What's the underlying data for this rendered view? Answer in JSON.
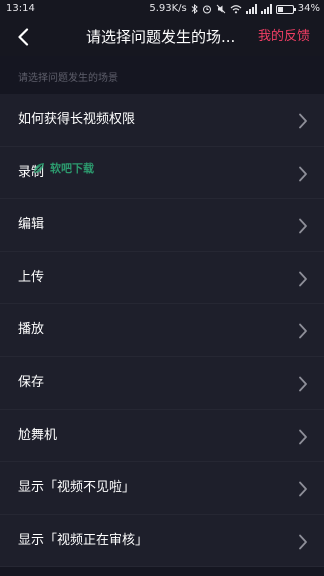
{
  "status_bar": {
    "time": "13:14",
    "network_speed": "5.93K/s",
    "battery_text": "34%",
    "battery_level": 0.34
  },
  "header": {
    "title": "请选择问题发生的场...",
    "feedback_link": "我的反馈"
  },
  "section_label": "请选择问题发生的场景",
  "scenarios": [
    {
      "label": "如何获得长视频权限"
    },
    {
      "label": "录制"
    },
    {
      "label": "编辑"
    },
    {
      "label": "上传"
    },
    {
      "label": "播放"
    },
    {
      "label": "保存"
    },
    {
      "label": "尬舞机"
    },
    {
      "label": "显示「视频不见啦」"
    },
    {
      "label": "显示「视频正在审核」"
    }
  ],
  "colors": {
    "accent": "#f03e64",
    "background": "#151621",
    "list_background": "#1e1f2b"
  }
}
